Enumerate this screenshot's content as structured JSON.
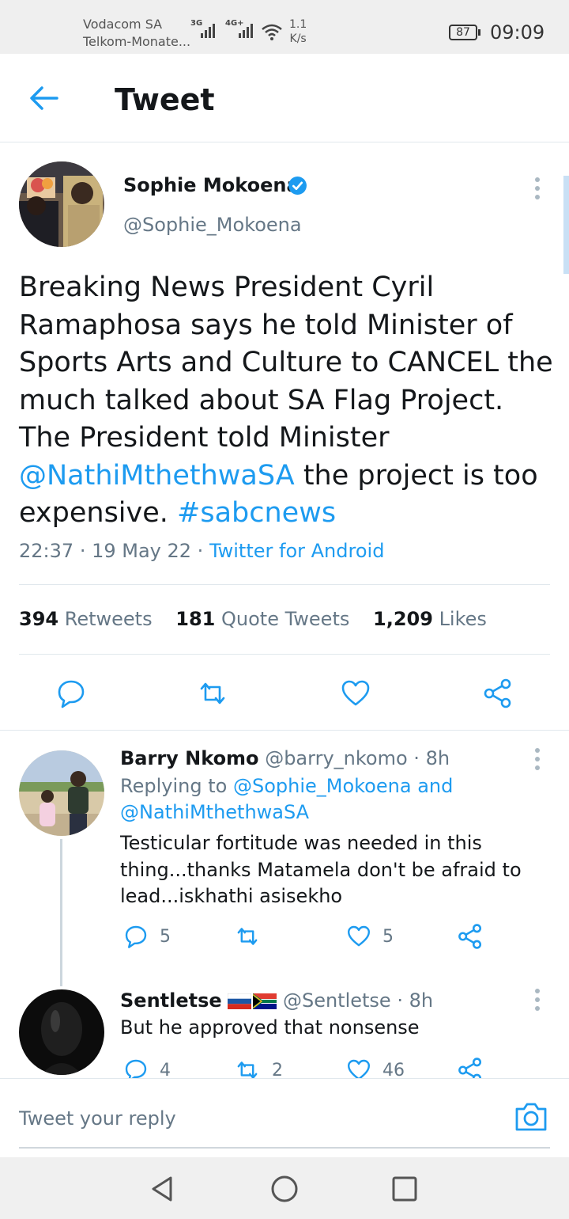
{
  "status_bar": {
    "carrier1": "Vodacom SA",
    "carrier2": "Telkom-Monate...",
    "net1": "3G",
    "net2": "4G+",
    "speed_value": "1.1",
    "speed_unit": "K/s",
    "battery": "87",
    "time": "09:09"
  },
  "header": {
    "title": "Tweet",
    "back_icon": "arrow-left-icon"
  },
  "tweet": {
    "name": "Sophie Mokoena",
    "handle": "@Sophie_Mokoena",
    "text_before_mention": "Breaking News President Cyril Ramaphosa says he told Minister of Sports Arts and Culture to CANCEL the much talked about SA Flag Project. The President told Minister ",
    "mention": "@NathiMthethwaSA",
    "text_after_mention": " the project is too expensive. ",
    "hashtag": "#sabcnews",
    "time": "22:37",
    "date": "19 May 22",
    "source": "Twitter for Android",
    "retweets_count": "394",
    "retweets_label": "Retweets",
    "quotes_count": "181",
    "quotes_label": "Quote Tweets",
    "likes_count": "1,209",
    "likes_label": "Likes"
  },
  "replies": [
    {
      "name": "Barry Nkomo",
      "handle": "@barry_nkomo",
      "age": "8h",
      "replying_prefix": "Replying to",
      "replying_to_1": "@Sophie_Mokoena",
      "replying_and": "and",
      "replying_to_2": "@NathiMthethwaSA",
      "text": "Testicular fortitude was needed in this thing...thanks Matamela don't be afraid to lead...iskhathi asisekho",
      "reply_count": "5",
      "retweet_count": "",
      "like_count": "5"
    },
    {
      "name": "Sentletse",
      "handle": "@Sentletse",
      "age": "8h",
      "text": "But he approved that nonsense",
      "reply_count": "4",
      "retweet_count": "2",
      "like_count": "46"
    }
  ],
  "composer": {
    "placeholder": "Tweet your reply"
  },
  "colors": {
    "link": "#1d9bf0",
    "secondary_text": "#657786",
    "divider": "#e1e8ed"
  }
}
